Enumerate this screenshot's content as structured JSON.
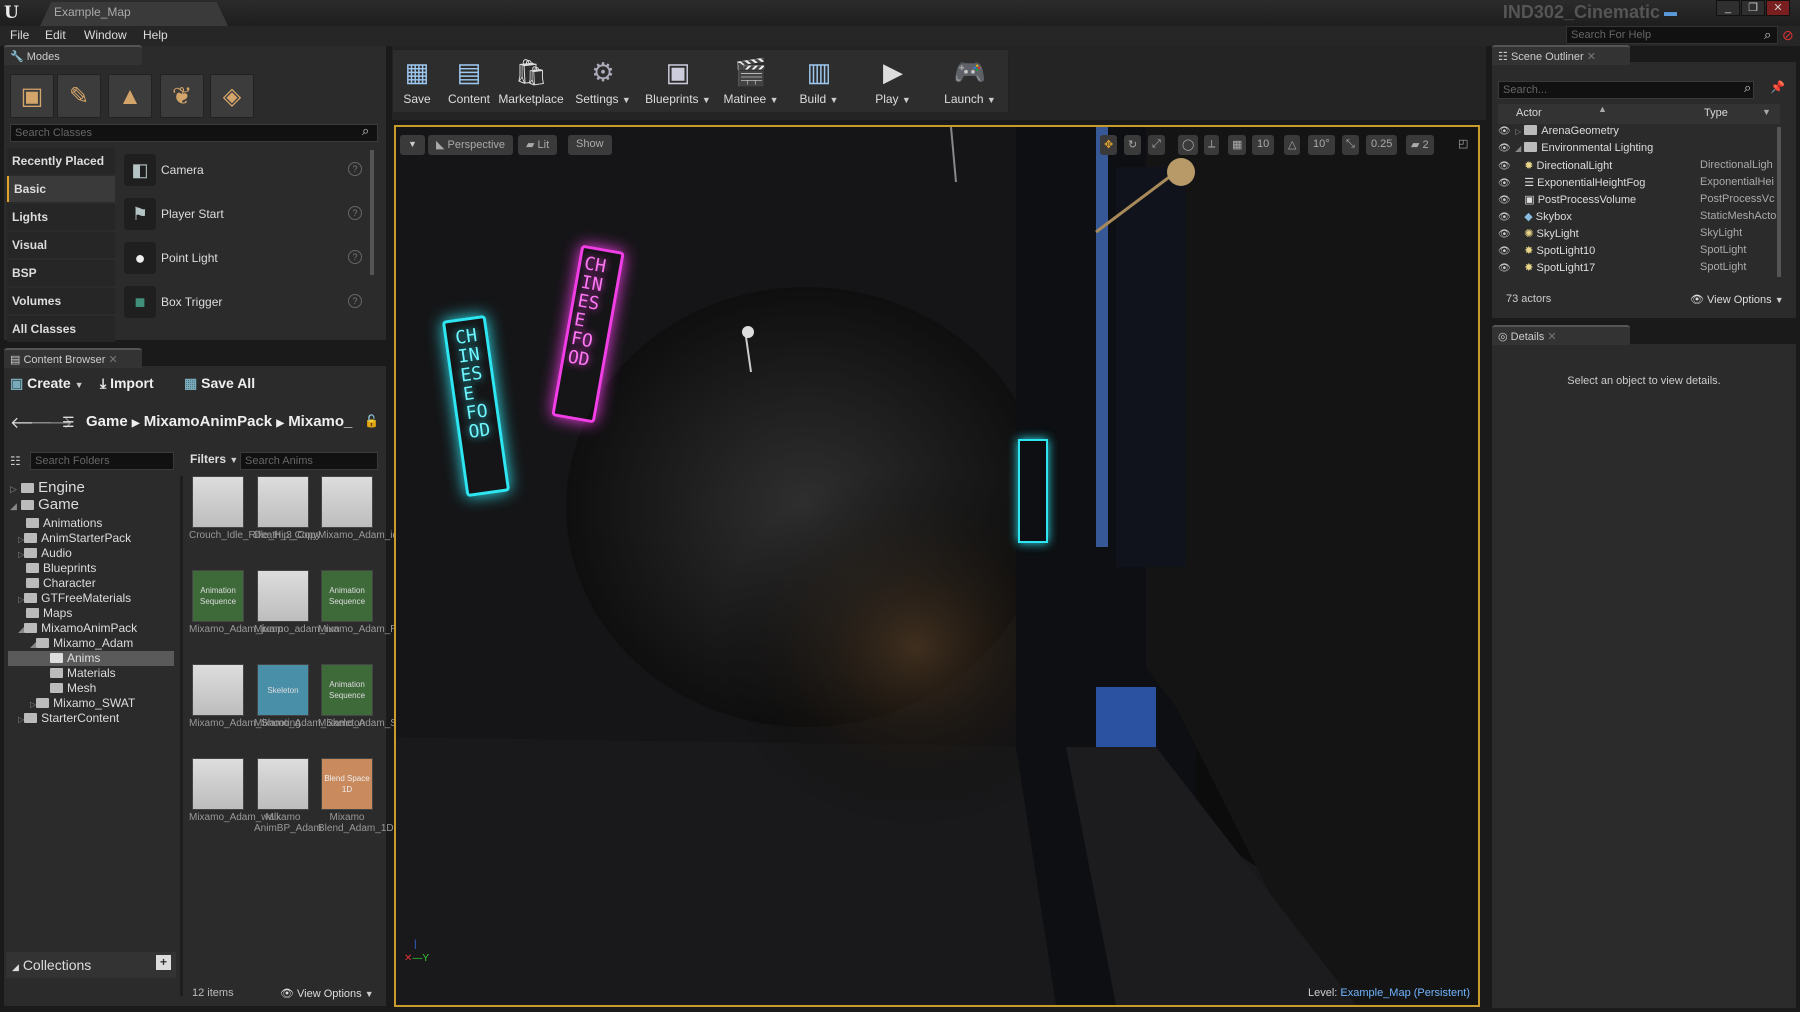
{
  "window": {
    "tab": "Example_Map",
    "project": "IND302_Cinematic",
    "controls": [
      "_",
      "❐",
      "✕"
    ]
  },
  "menu": {
    "items": [
      "File",
      "Edit",
      "Window",
      "Help"
    ],
    "help_search": "Search For Help"
  },
  "modes": {
    "tab": "Modes",
    "search_placeholder": "Search Classes",
    "categories": [
      "Recently Placed",
      "Basic",
      "Lights",
      "Visual",
      "BSP",
      "Volumes",
      "All Classes"
    ],
    "items": [
      "Camera",
      "Player Start",
      "Point Light",
      "Box Trigger"
    ]
  },
  "toolbar": {
    "buttons": [
      "Save",
      "Content",
      "Marketplace",
      "Settings",
      "Blueprints",
      "Matinee",
      "Build",
      "Play",
      "Launch"
    ]
  },
  "viewport": {
    "perspective": "Perspective",
    "lit": "Lit",
    "show": "Show",
    "grid": "10",
    "rot": "10°",
    "scale": "0.25",
    "cam": "2",
    "level_label": "Level:",
    "level_name": "Example_Map (Persistent)",
    "sign_text_1": "CHINESE FOOD",
    "sign_text_2": "CHINESE FOOD"
  },
  "content_browser": {
    "tab": "Content Browser",
    "create": "Create",
    "import": "Import",
    "save_all": "Save All",
    "crumbs": [
      "Game",
      "MixamoAnimPack",
      "Mixamo_"
    ],
    "search_folders": "Search Folders",
    "filters": "Filters",
    "search_anims": "Search Anims",
    "tree": [
      "Engine",
      "Game",
      "Animations",
      "AnimStarterPack",
      "Audio",
      "Blueprints",
      "Character",
      "GTFreeMaterials",
      "Maps",
      "MixamoAnimPack",
      "Mixamo_Adam",
      "Anims",
      "Materials",
      "Mesh",
      "Mixamo_SWAT",
      "StarterContent"
    ],
    "assets": [
      {
        "label": "Crouch_Idle_Rifle_Hip_Copy",
        "thumb": ""
      },
      {
        "label": "Death_3_Copy",
        "thumb": ""
      },
      {
        "label": "Mixamo_Adam_idle",
        "thumb": ""
      },
      {
        "label": "Mixamo_Adam_jump",
        "thumb": "Animation Sequence"
      },
      {
        "label": "Mixamo_adam_run",
        "thumb": ""
      },
      {
        "label": "Mixamo_Adam_Running_",
        "thumb": "Animation Sequence"
      },
      {
        "label": "Mixamo_Adam_Shooting",
        "thumb": ""
      },
      {
        "label": "Mixamo_Adam_Skeleton",
        "thumb": "Skeleton"
      },
      {
        "label": "Mixamo_Adam_Sword_",
        "thumb": "Animation Sequence"
      },
      {
        "label": "Mixamo_Adam_walk",
        "thumb": ""
      },
      {
        "label": "Mixamo AnimBP_Adam",
        "thumb": ""
      },
      {
        "label": "Mixamo Blend_Adam_1D",
        "thumb": "Blend Space 1D"
      }
    ],
    "collections": "Collections",
    "count": "12 items",
    "view_options": "View Options"
  },
  "outliner": {
    "tab": "Scene Outliner",
    "search": "Search...",
    "col_actor": "Actor",
    "col_type": "Type",
    "actors_count": "73 actors",
    "view_options": "View Options",
    "rows": [
      {
        "name": "ArenaGeometry",
        "type": ""
      },
      {
        "name": "Environmental Lighting",
        "type": ""
      },
      {
        "name": "DirectionalLight",
        "type": "DirectionalLigh"
      },
      {
        "name": "ExponentialHeightFog",
        "type": "ExponentialHei"
      },
      {
        "name": "PostProcessVolume",
        "type": "PostProcessVc"
      },
      {
        "name": "Skybox",
        "type": "StaticMeshActo"
      },
      {
        "name": "SkyLight",
        "type": "SkyLight"
      },
      {
        "name": "SpotLight10",
        "type": "SpotLight"
      },
      {
        "name": "SpotLight17",
        "type": "SpotLight"
      }
    ]
  },
  "details": {
    "tab": "Details",
    "message": "Select an object to view details."
  }
}
